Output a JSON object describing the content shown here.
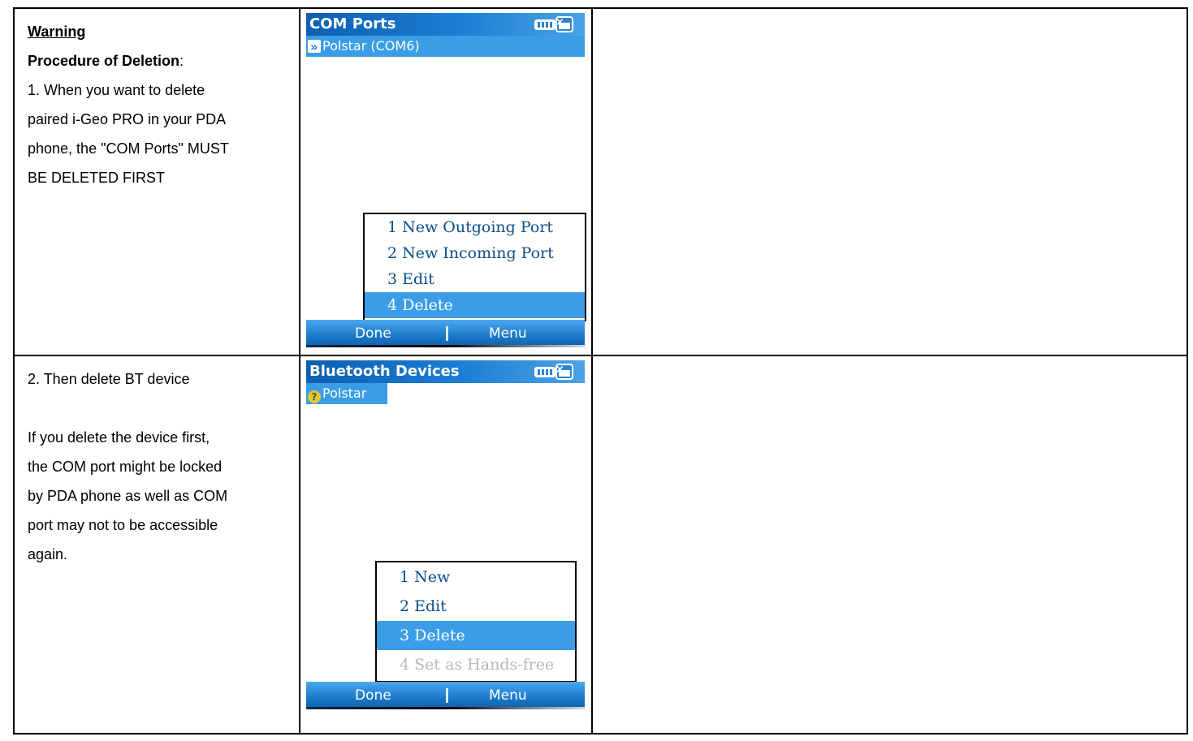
{
  "row1": {
    "warning": "Warning",
    "procedure_label": "Procedure of Deletion",
    "procedure_colon": ":",
    "step1_lines": [
      "1.   When you want to delete",
      "paired i-Geo PRO in your PDA",
      "phone, the \"COM Ports\" MUST",
      "BE DELETED FIRST"
    ],
    "screen": {
      "title": "COM Ports",
      "list_item": "Polstar (COM6)",
      "menu_items": [
        "1 New Outgoing Port",
        "2 New Incoming Port",
        "3 Edit",
        "4 Delete"
      ],
      "selected_index": 3,
      "soft_left": "Done",
      "soft_right": "Menu"
    }
  },
  "row2": {
    "step2": "2. Then delete BT device",
    "note_lines": [
      "If you delete the device first,",
      "the COM port might be locked",
      "by PDA phone as well as COM",
      "port may not to be accessible",
      "again."
    ],
    "screen": {
      "title": "Bluetooth Devices",
      "list_item": "Polstar",
      "menu_items": [
        "1 New",
        "2 Edit",
        "3 Delete",
        "4 Set as Hands-free"
      ],
      "selected_index": 2,
      "disabled_index": 3,
      "soft_left": "Done",
      "soft_right": "Menu"
    }
  },
  "colors": {
    "accent": "#3a9de6",
    "title_bar": "#1b7ed4",
    "menu_text": "#0b4f8a"
  },
  "icons": {
    "battery": "battery-icon",
    "phone_signal": "phone-icon",
    "bluetooth_port": "bluetooth-port-icon",
    "unknown_device": "question-device-icon"
  }
}
